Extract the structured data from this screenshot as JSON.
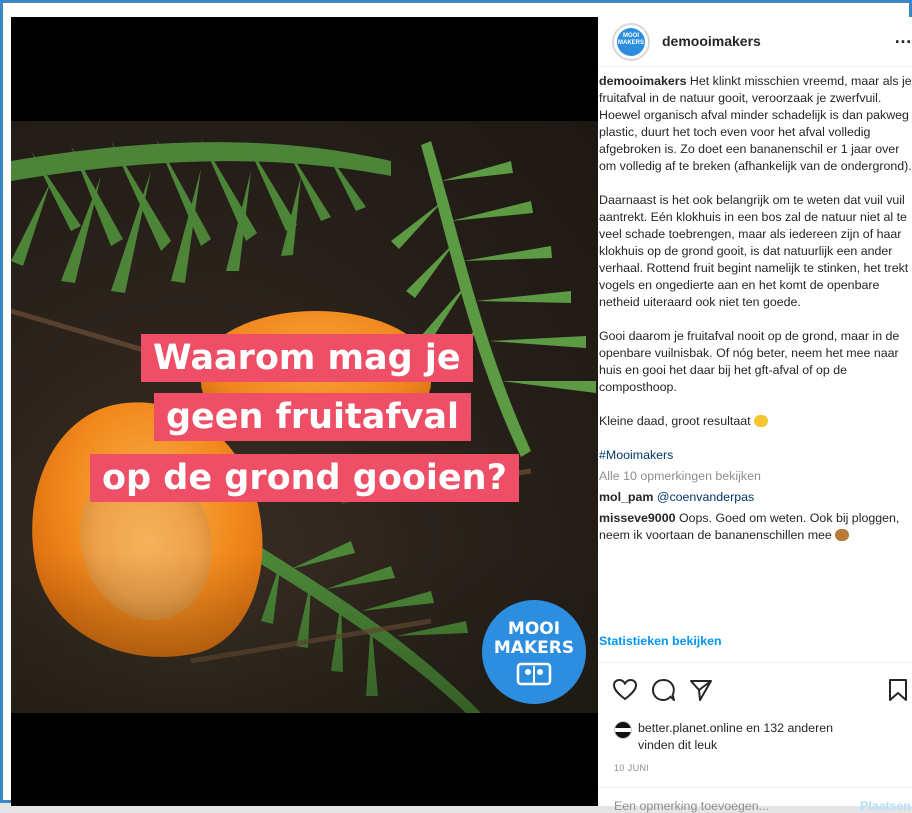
{
  "post": {
    "headline": [
      "Waarom mag je",
      "geen fruitafval",
      "op de grond gooien?"
    ],
    "logo": {
      "line1": "MOOI",
      "line2": "MAKERS"
    }
  },
  "header": {
    "avatar_text": [
      "MOOI",
      "MAKERS"
    ],
    "username": "demooimakers",
    "more_icon": "…"
  },
  "caption": {
    "username": "demooimakers",
    "p1": "Het klinkt misschien vreemd, maar als je fruitafval in de natuur gooit, veroorzaak je zwerfvuil. Hoewel organisch afval minder schadelijk is dan pakweg plastic, duurt het toch even voor het afval volledig afgebroken is. Zo doet een bananenschil er 1 jaar over om volledig af te breken (afhankelijk van de ondergrond).",
    "p2": "Daarnaast is het ook belangrijk om te weten dat vuil vuil aantrekt. Eén klokhuis in een bos zal de natuur niet al te veel schade toebrengen, maar als iedereen zijn of haar klokhuis op de grond gooit, is dat natuurlijk een ander verhaal. Rottend fruit begint namelijk te stinken, het trekt vogels en ongedierte aan en het komt de openbare netheid uiteraard ook niet ten goede.",
    "p3": "Gooi daarom je fruitafval nooit op de grond, maar in de openbare vuilnisbak. Of nóg beter, neem het mee naar huis en gooi het daar bij het gft-afval of op de composthoop.",
    "p4": "Kleine daad, groot resultaat",
    "hashtag": "#Mooimakers",
    "view_comments": "Alle 10 opmerkingen bekijken"
  },
  "comments": [
    {
      "user": "mol_pam",
      "text": "@coenvanderpas"
    },
    {
      "user": "misseve9000",
      "text": "Oops. Goed om weten. Ook bij ploggen, neem ik voortaan de bananenschillen mee"
    }
  ],
  "stats_link": "Statistieken bekijken",
  "likes": {
    "user": "better.planet.online",
    "connector": " en ",
    "others": "132 anderen",
    "suffix": "vinden dit leuk"
  },
  "date": "10 JUNI",
  "add_comment": {
    "placeholder": "Een opmerking toevoegen...",
    "post_label": "Plaatsen"
  },
  "colors": {
    "headline_bg": "#ef4f66",
    "brand_blue": "#2d8ee0",
    "link": "#00376b",
    "stats": "#0095f6"
  },
  "icons": [
    "heart-icon",
    "comment-icon",
    "share-icon",
    "bookmark-icon",
    "more-icon",
    "fist-emoji",
    "hand-emoji"
  ]
}
